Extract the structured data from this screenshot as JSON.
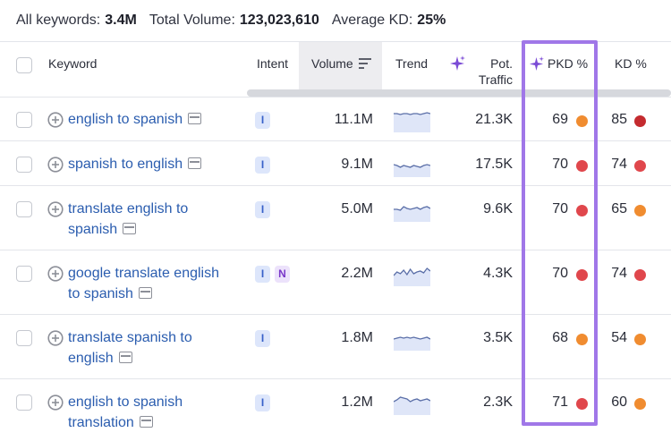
{
  "summary": {
    "keywords_label": "All keywords:",
    "keywords_value": "3.4M",
    "volume_label": "Total Volume:",
    "volume_value": "123,023,610",
    "kd_label": "Average KD:",
    "kd_value": "25%"
  },
  "columns": {
    "keyword": "Keyword",
    "intent": "Intent",
    "volume": "Volume",
    "trend": "Trend",
    "pot_traffic_1": "Pot.",
    "pot_traffic_2": "Traffic",
    "pkd": "PKD %",
    "kd": "KD %"
  },
  "colors": {
    "accent_purple": "#a077e8",
    "link_blue": "#2b5daf",
    "dot_red": "#e0474c",
    "dot_orange": "#f08c30",
    "dot_dark_red": "#c42b2f"
  },
  "rows": [
    {
      "kw1": "english to spanish",
      "kw2": "",
      "intent": [
        "I"
      ],
      "volume": "11.1M",
      "traffic": "21.3K",
      "pkd": "69",
      "pkd_color": "#f08c30",
      "kd": "85",
      "kd_color": "#c42b2f",
      "trend": [
        0.15,
        0.15,
        0.2,
        0.15,
        0.15,
        0.2,
        0.15,
        0.15,
        0.2,
        0.15,
        0.1,
        0.15
      ]
    },
    {
      "kw1": "spanish to english",
      "kw2": "",
      "intent": [
        "I"
      ],
      "volume": "9.1M",
      "traffic": "17.5K",
      "pkd": "70",
      "pkd_color": "#e0474c",
      "kd": "74",
      "kd_color": "#e0474c",
      "trend": [
        0.5,
        0.55,
        0.65,
        0.55,
        0.6,
        0.65,
        0.55,
        0.6,
        0.65,
        0.55,
        0.5,
        0.55
      ]
    },
    {
      "kw1": "translate english to",
      "kw2": "spanish",
      "intent": [
        "I"
      ],
      "volume": "5.0M",
      "traffic": "9.6K",
      "pkd": "70",
      "pkd_color": "#e0474c",
      "kd": "65",
      "kd_color": "#f08c30",
      "trend": [
        0.5,
        0.5,
        0.55,
        0.35,
        0.45,
        0.5,
        0.45,
        0.4,
        0.5,
        0.4,
        0.35,
        0.45
      ]
    },
    {
      "kw1": "google translate english",
      "kw2": "to spanish",
      "intent": [
        "I",
        "N"
      ],
      "volume": "2.2M",
      "traffic": "4.3K",
      "pkd": "70",
      "pkd_color": "#e0474c",
      "kd": "74",
      "kd_color": "#e0474c",
      "trend": [
        0.6,
        0.4,
        0.5,
        0.3,
        0.55,
        0.25,
        0.5,
        0.4,
        0.35,
        0.45,
        0.2,
        0.35
      ]
    },
    {
      "kw1": "translate spanish to",
      "kw2": "english",
      "intent": [
        "I"
      ],
      "volume": "1.8M",
      "traffic": "3.5K",
      "pkd": "68",
      "pkd_color": "#f08c30",
      "kd": "54",
      "kd_color": "#f08c30",
      "trend": [
        0.55,
        0.5,
        0.45,
        0.5,
        0.45,
        0.5,
        0.45,
        0.5,
        0.55,
        0.5,
        0.45,
        0.55
      ]
    },
    {
      "kw1": "english to spanish",
      "kw2": "translation",
      "intent": [
        "I"
      ],
      "volume": "1.2M",
      "traffic": "2.3K",
      "pkd": "71",
      "pkd_color": "#e0474c",
      "kd": "60",
      "kd_color": "#f08c30",
      "trend": [
        0.45,
        0.35,
        0.2,
        0.25,
        0.3,
        0.45,
        0.35,
        0.3,
        0.4,
        0.35,
        0.3,
        0.4
      ]
    }
  ]
}
